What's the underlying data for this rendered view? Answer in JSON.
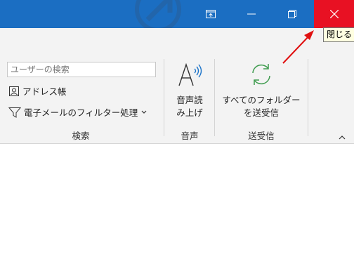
{
  "titlebar": {
    "color": "#1b6ec2",
    "close_color": "#e81123",
    "tooltip": "閉じる"
  },
  "ribbon": {
    "search": {
      "placeholder": "ユーザーの検索",
      "address_book": "アドレス帳",
      "filter_email": "電子メールのフィルター処理",
      "group_label": "検索"
    },
    "speech": {
      "read_aloud_line1": "音声読",
      "read_aloud_line2": "み上げ",
      "group_label": "音声"
    },
    "send_receive": {
      "all_folders_line1": "すべてのフォルダー",
      "all_folders_line2": "を送受信",
      "group_label": "送受信"
    }
  },
  "annotation": {
    "arrow_color": "#e01010"
  }
}
